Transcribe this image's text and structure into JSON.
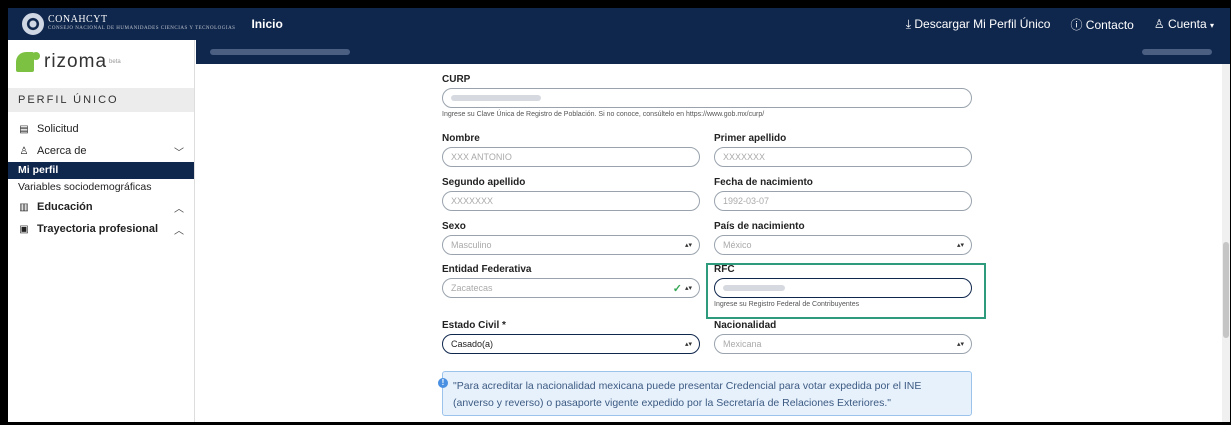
{
  "topbar": {
    "brand": "CONAHCYT",
    "brand_sub": "CONSEJO NACIONAL DE HUMANIDADES CIENCIAS Y TECNOLOGÍAS",
    "inicio": "Inicio",
    "descargar": "Descargar Mi Perfil Único",
    "contacto": "Contacto",
    "cuenta": "Cuenta"
  },
  "sidebar": {
    "logo_text": "rizoma",
    "logo_badge": "beta",
    "section": "PERFIL ÚNICO",
    "items": [
      {
        "label": "Solicitud"
      },
      {
        "label": "Acerca de"
      },
      {
        "label": "Mi perfil"
      },
      {
        "label": "Variables sociodemográficas"
      },
      {
        "label": "Educación"
      },
      {
        "label": "Trayectoria profesional"
      }
    ]
  },
  "form": {
    "curp": {
      "label": "CURP",
      "help": "Ingrese su Clave Única de Registro de Población. Si no conoce, consúltelo en https://www.gob.mx/curp/"
    },
    "nombre": {
      "label": "Nombre",
      "value": "XXX ANTONIO"
    },
    "primer_apellido": {
      "label": "Primer apellido",
      "value": "XXXXXXX"
    },
    "segundo_apellido": {
      "label": "Segundo apellido",
      "value": "XXXXXXX"
    },
    "fecha_nacimiento": {
      "label": "Fecha de nacimiento",
      "value": "1992-03-07"
    },
    "sexo": {
      "label": "Sexo",
      "value": "Masculino"
    },
    "pais_nacimiento": {
      "label": "País de nacimiento",
      "value": "México"
    },
    "entidad": {
      "label": "Entidad Federativa",
      "value": "Zacatecas"
    },
    "rfc": {
      "label": "RFC",
      "help": "Ingrese su Registro Federal de Contribuyentes"
    },
    "estado_civil": {
      "label": "Estado Civil *",
      "value": "Casado(a)"
    },
    "nacionalidad": {
      "label": "Nacionalidad",
      "value": "Mexicana"
    }
  },
  "info": {
    "text": "\"Para acreditar la nacionalidad mexicana puede presentar Credencial para votar expedida por el INE (anverso y reverso) o pasaporte vigente expedido por la Secretaría de Relaciones Exteriores.\""
  },
  "colors": {
    "navy": "#10274d",
    "green": "#7cc142",
    "highlight": "#2e9c7c"
  }
}
